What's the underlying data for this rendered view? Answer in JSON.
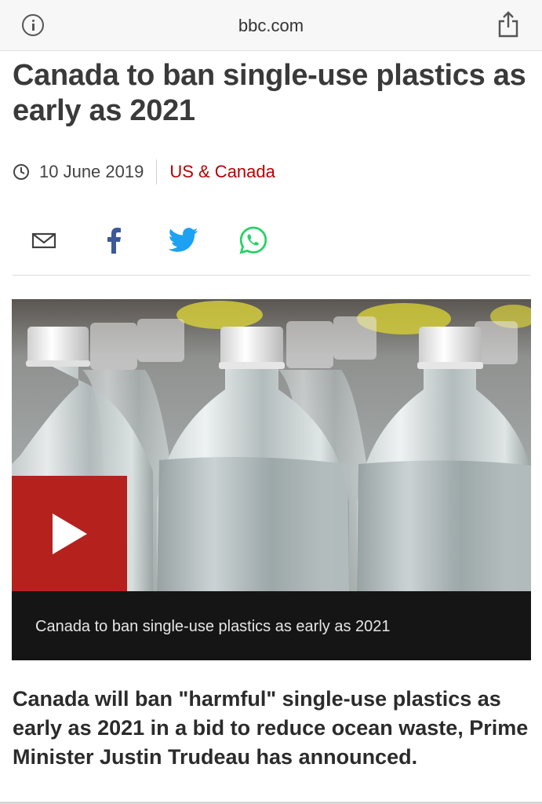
{
  "browser": {
    "domain": "bbc.com",
    "info_icon": "info-icon",
    "share_icon": "share-icon"
  },
  "article": {
    "headline": "Canada to ban single-use plastics as early as 2021",
    "date": "10 June 2019",
    "section": "US & Canada",
    "intro": "Canada will ban \"harmful\" single-use plastics as early as 2021 in a bid to reduce ocean waste, Prime Minister Justin Trudeau has announced."
  },
  "share": {
    "items": [
      {
        "icon": "email-icon",
        "color": "#404040"
      },
      {
        "icon": "facebook-icon",
        "color": "#3b5998"
      },
      {
        "icon": "twitter-icon",
        "color": "#1da1f2"
      },
      {
        "icon": "whatsapp-icon",
        "color": "#25d366"
      }
    ]
  },
  "video": {
    "caption": "Canada to ban single-use plastics as early as 2021",
    "play_icon": "play-icon",
    "image_content": "clear plastic water bottles with white caps"
  },
  "colors": {
    "brand_red": "#b80000",
    "play_red": "#b5221e",
    "caption_bg": "#151515"
  }
}
